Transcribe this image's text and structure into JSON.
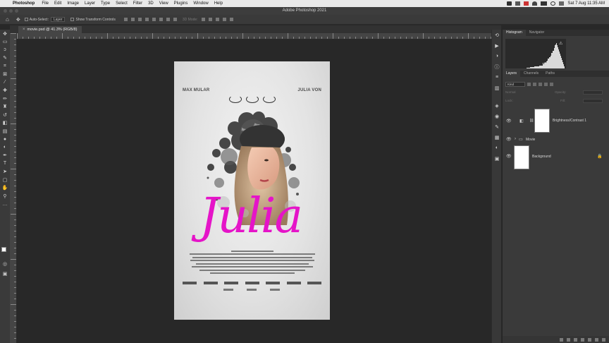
{
  "menubar": {
    "items": [
      "Photoshop",
      "File",
      "Edit",
      "Image",
      "Layer",
      "Type",
      "Select",
      "Filter",
      "3D",
      "View",
      "Plugins",
      "Window",
      "Help"
    ],
    "datetime": "Sat 7 Aug  11:35 AM"
  },
  "window": {
    "title": "Adobe Photoshop 2021"
  },
  "options": {
    "auto_select_label": "Auto-Select:",
    "auto_select_value": "Layer",
    "show_transform_label": "Show Transform Controls",
    "mode_3d": "3D Mode:"
  },
  "document": {
    "tab_label": "movie.psd @ 41.3% (RGB/8)"
  },
  "poster": {
    "actor_left": "MAX MULAR",
    "actor_right": "JULIA VON",
    "title": "Julia",
    "title_color": "#e514c8"
  },
  "panels": {
    "top_tabs": [
      "Histogram",
      "Navigator"
    ],
    "layer_tabs": [
      "Layers",
      "Channels",
      "Paths"
    ],
    "filter_kind": "Kind",
    "blend_mode": "Normal",
    "opacity_label": "Opacity:",
    "lock_label": "Lock:",
    "fill_label": "Fill:",
    "layers": [
      {
        "name": "Brightness/Contrast 1"
      },
      {
        "name": "Movie"
      },
      {
        "name": "Background"
      }
    ]
  }
}
